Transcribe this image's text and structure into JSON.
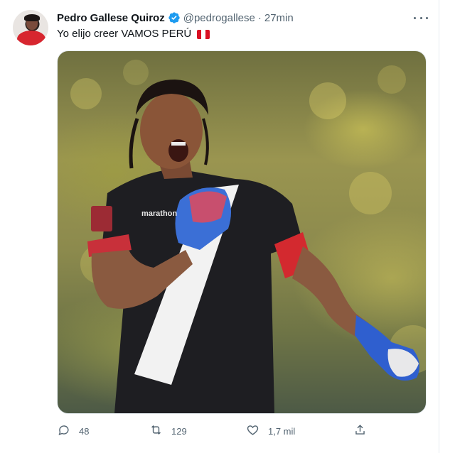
{
  "tweet": {
    "author_name": "Pedro Gallese Quiroz",
    "handle": "@pedrogallese",
    "separator": "·",
    "time": "27min",
    "text": "Yo elijo creer VAMOS PERÚ",
    "verified": true,
    "flag_colors": [
      "#d91023",
      "#ffffff",
      "#d91023"
    ]
  },
  "media": {
    "jersey_brand": "marathon"
  },
  "actions": {
    "reply_count": "48",
    "retweet_count": "129",
    "like_count": "1,7 mil"
  },
  "colors": {
    "verified_blue": "#1d9bf0",
    "secondary_text": "#536471",
    "primary_text": "#0f1419"
  }
}
